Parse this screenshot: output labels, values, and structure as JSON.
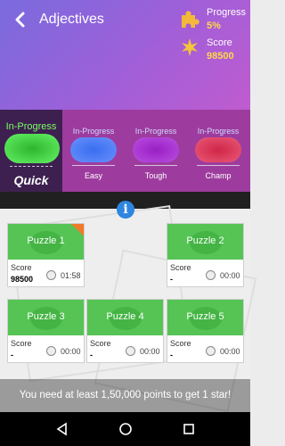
{
  "header": {
    "title": "Adjectives",
    "progress_label": "Progress",
    "progress_value": "5%",
    "score_label": "Score",
    "score_value": "98500",
    "colors": {
      "gradient_start": "#7a6bde",
      "gradient_end": "#c05ccf",
      "accent": "#ffd84a"
    }
  },
  "modes": [
    {
      "tag": "In-Progress",
      "name": "Quick",
      "color": "#39c639",
      "active": true
    },
    {
      "tag": "In-Progress",
      "name": "Easy",
      "color": "#3b6ff0",
      "active": false
    },
    {
      "tag": "In-Progress",
      "name": "Tough",
      "color": "#a02bc8",
      "active": false
    },
    {
      "tag": "In-Progress",
      "name": "Champ",
      "color": "#d92f52",
      "active": false
    }
  ],
  "puzzles": [
    {
      "title": "Puzzle 1",
      "score_label": "Score",
      "score": "98500",
      "time": "01:58",
      "new": true
    },
    {
      "title": "Puzzle 2",
      "score_label": "Score",
      "score": "-",
      "time": "00:00",
      "new": false
    },
    {
      "title": "Puzzle 3",
      "score_label": "Score",
      "score": "-",
      "time": "00:00",
      "new": false
    },
    {
      "title": "Puzzle 4",
      "score_label": "Score",
      "score": "-",
      "time": "00:00",
      "new": false
    },
    {
      "title": "Puzzle 5",
      "score_label": "Score",
      "score": "-",
      "time": "00:00",
      "new": false
    }
  ],
  "info_icon": "i",
  "bottom_message": "You need at least 1,50,000 points to get 1 star!",
  "navbar": {
    "icons": [
      "back-triangle-icon",
      "home-circle-icon",
      "recents-square-icon"
    ]
  }
}
